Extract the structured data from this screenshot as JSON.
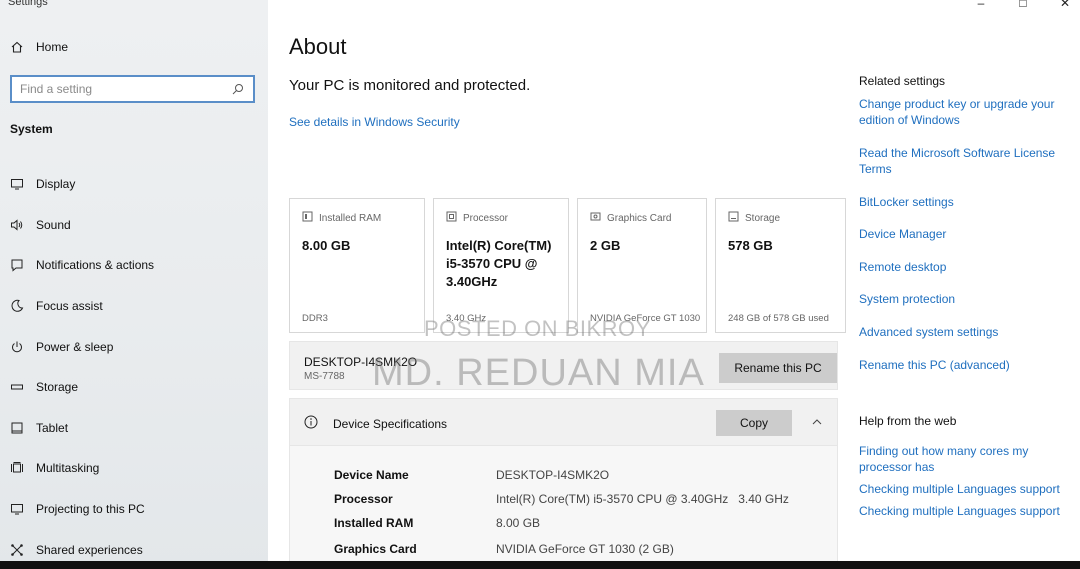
{
  "app": {
    "title": "Settings"
  },
  "window_controls": {
    "minimize": "–",
    "maximize": "□",
    "close": "✕"
  },
  "sidebar": {
    "home_label": "Home",
    "search_placeholder": "Find a setting",
    "section_label": "System",
    "items": [
      {
        "label": "Display",
        "icon": "monitor-icon"
      },
      {
        "label": "Sound",
        "icon": "speaker-icon"
      },
      {
        "label": "Notifications & actions",
        "icon": "notification-icon"
      },
      {
        "label": "Focus assist",
        "icon": "moon-icon"
      },
      {
        "label": "Power & sleep",
        "icon": "power-icon"
      },
      {
        "label": "Storage",
        "icon": "storage-icon"
      },
      {
        "label": "Tablet",
        "icon": "tablet-icon"
      },
      {
        "label": "Multitasking",
        "icon": "multitasking-icon"
      },
      {
        "label": "Projecting to this PC",
        "icon": "projector-icon"
      },
      {
        "label": "Shared experiences",
        "icon": "shared-icon"
      }
    ]
  },
  "main": {
    "title": "About",
    "status": "Your PC is monitored and protected.",
    "security_link": "See details in Windows Security",
    "cards": [
      {
        "label": "Installed RAM",
        "value": "8.00 GB",
        "footer": "DDR3",
        "icon": "ram-icon"
      },
      {
        "label": "Processor",
        "value": "Intel(R) Core(TM) i5-3570 CPU @ 3.40GHz",
        "footer": "3.40 GHz",
        "icon": "processor-icon"
      },
      {
        "label": "Graphics Card",
        "value": "2 GB",
        "footer": "NVIDIA GeForce GT 1030",
        "icon": "graphics-card-icon"
      },
      {
        "label": "Storage",
        "value": "578 GB",
        "footer": "248 GB of 578 GB used",
        "icon": "storage-icon"
      }
    ],
    "pc": {
      "name": "DESKTOP-I4SMK2O",
      "model": "MS-7788",
      "rename_label": "Rename this PC"
    },
    "specs": {
      "title": "Device Specifications",
      "copy_label": "Copy",
      "rows": [
        {
          "key": "Device Name",
          "value": "DESKTOP-I4SMK2O"
        },
        {
          "key": "Processor",
          "value": "Intel(R) Core(TM) i5-3570 CPU @ 3.40GHz   3.40 GHz"
        },
        {
          "key": "Installed RAM",
          "value": "8.00 GB"
        },
        {
          "key": "Graphics Card",
          "value": "NVIDIA GeForce GT 1030 (2 GB)"
        }
      ]
    }
  },
  "related": {
    "heading": "Related settings",
    "links": [
      "Change product key or upgrade your edition of Windows",
      "Read the Microsoft Software License Terms",
      "BitLocker settings",
      "Device Manager",
      "Remote desktop",
      "System protection",
      "Advanced system settings",
      "Rename this PC (advanced)"
    ]
  },
  "help": {
    "heading": "Help from the web",
    "links": [
      "Finding out how many cores my processor has",
      "Checking multiple Languages support",
      "Checking multiple Languages support"
    ]
  },
  "watermark": {
    "line1": "POSTED ON BIKROY",
    "line2": "MD. REDUAN MIA"
  },
  "colors": {
    "link": "#1f6fbf",
    "search_border": "#5a8ec8",
    "button_bg": "#cccccc"
  }
}
